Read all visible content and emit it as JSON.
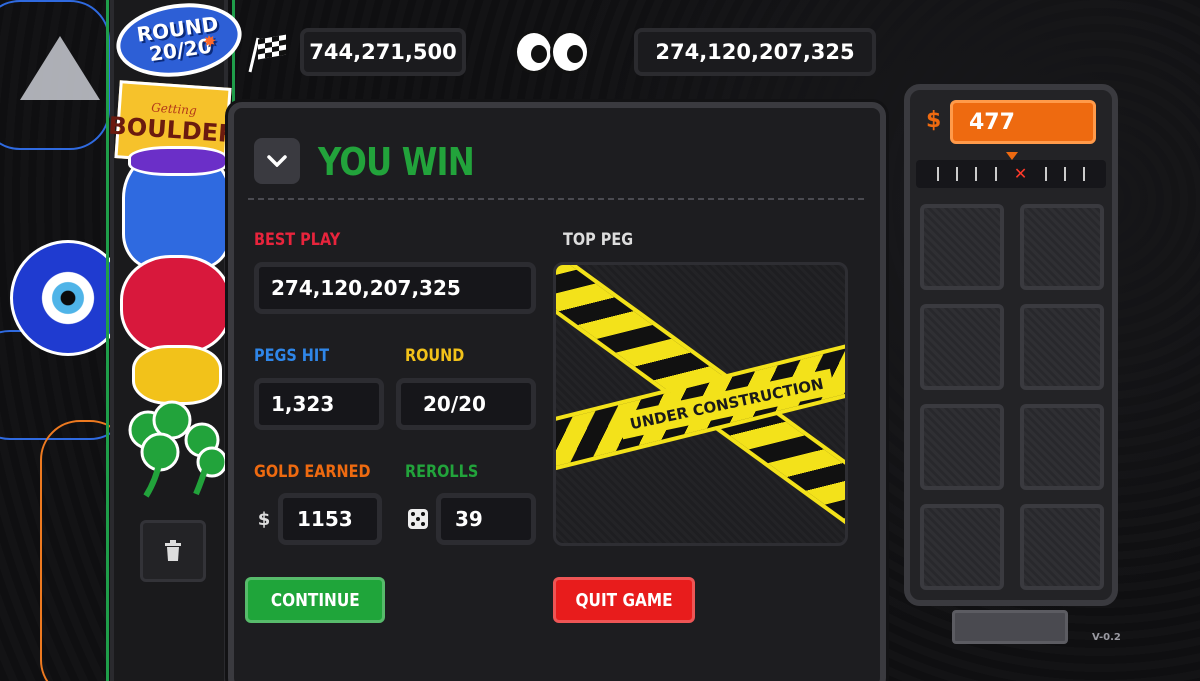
{
  "round_badge": {
    "line1": "ROUND",
    "line2": "20/20"
  },
  "boulder_sticker": {
    "script": "Getting",
    "title": "BOULDER"
  },
  "top_stats": {
    "left_score": "744,271,500",
    "right_score": "274,120,207,325"
  },
  "modal": {
    "title": "YOU WIN",
    "best_play": {
      "label": "BEST PLAY",
      "value": "274,120,207,325"
    },
    "pegs_hit": {
      "label": "PEGS HIT",
      "value": "1,323"
    },
    "round": {
      "label": "ROUND",
      "value": "20/20"
    },
    "gold_earned": {
      "label": "GOLD EARNED",
      "prefix": "$",
      "value": "1153"
    },
    "rerolls": {
      "label": "REROLLS",
      "value": "39"
    },
    "top_peg": {
      "label": "TOP PEG",
      "tape_text": "UNDER CONSTRUCTION"
    },
    "continue_label": "CONTINUE",
    "quit_label": "QUIT GAME"
  },
  "right_panel": {
    "gold_sign": "$",
    "gold_value": "477",
    "ruler_mark": "✕"
  },
  "version": "V-0.2",
  "colors": {
    "win_green": "#22a33b",
    "best_play_red": "#e8243c",
    "pegs_blue": "#2f86e8",
    "round_yellow": "#f2c21a",
    "gold_orange": "#ee6a10",
    "rerolls_green": "#22a33b",
    "continue_green": "#1fa53a",
    "quit_red": "#e81c1c"
  }
}
